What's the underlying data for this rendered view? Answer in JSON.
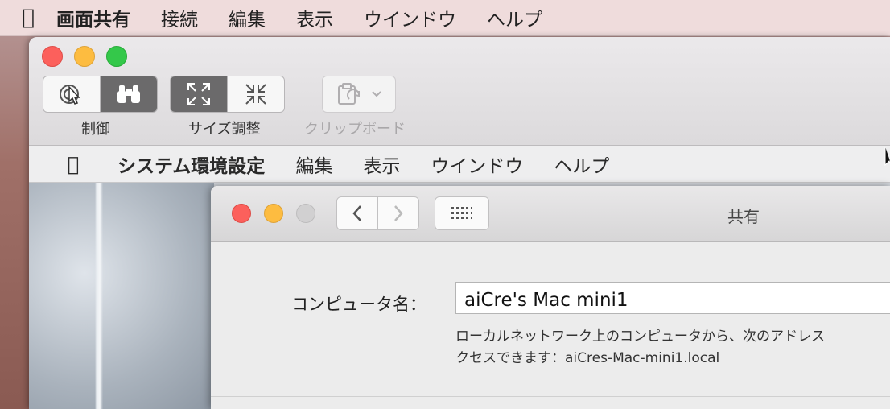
{
  "host_menubar": {
    "items": [
      "画面共有",
      "接続",
      "編集",
      "表示",
      "ウインドウ",
      "ヘルプ"
    ]
  },
  "toolbar": {
    "control_label": "制御",
    "resize_label": "サイズ調整",
    "clipboard_label": "クリップボード"
  },
  "remote_menubar": {
    "items": [
      "システム環境設定",
      "編集",
      "表示",
      "ウインドウ",
      "ヘルプ"
    ]
  },
  "prefs": {
    "title": "共有",
    "computer_name_label": "コンピュータ名：",
    "computer_name_value": "aiCre's Mac mini1",
    "desc_line1": "ローカルネットワーク上のコンピュータから、次のアドレス",
    "desc_line2": "クセスできます：aiCres-Mac-mini1.local"
  },
  "colors": {
    "close": "#fc605c",
    "minimize": "#fdbc40",
    "zoom": "#34c84a",
    "segment_active": "#6b6a6b"
  }
}
